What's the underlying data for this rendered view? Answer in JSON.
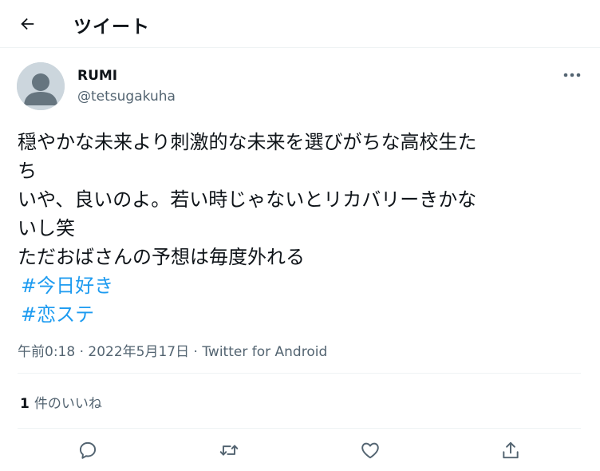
{
  "header": {
    "back_icon": "arrow-left-icon",
    "title": "ツイート"
  },
  "author": {
    "display_name": "RUMI",
    "handle": "@tetsugakuha"
  },
  "tweet": {
    "lines": [
      "穏やかな未来より刺激的な未来を選びがちな高校生た",
      "ち",
      "いや、良いのよ。若い時じゃないとリカバリーきかな",
      "いし笑",
      "ただおばさんの予想は毎度外れる"
    ],
    "hashtags": [
      "#今日好き",
      "#恋ステ"
    ]
  },
  "meta": {
    "time": "午前0:18",
    "date": "2022年5月17日",
    "separator": "·",
    "source": "Twitter for Android"
  },
  "likes": {
    "count": "1",
    "label": "件のいいね"
  },
  "actions": [
    "reply-icon",
    "retweet-icon",
    "like-icon",
    "share-icon"
  ],
  "colors": {
    "accent": "#1d9bf0",
    "text": "#0f1419",
    "secondary": "#536471",
    "divider": "#eff3f4"
  }
}
